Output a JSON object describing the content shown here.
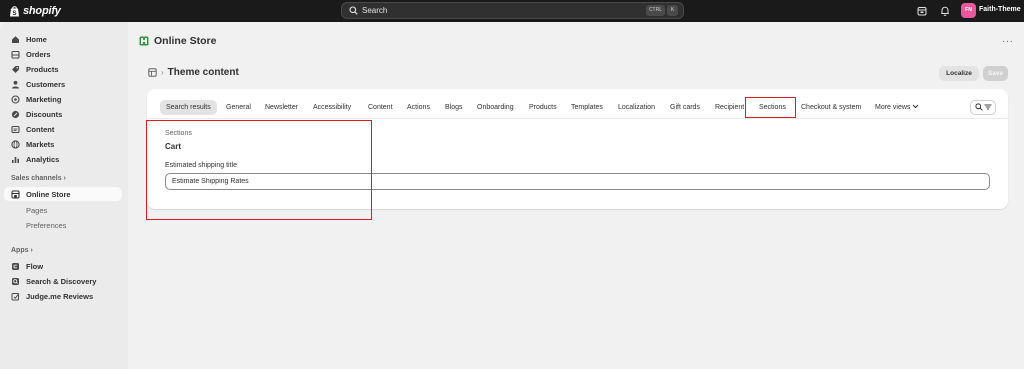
{
  "topbar": {
    "logo_text": "shopify",
    "search_label": "Search",
    "search_kbd_1": "CTRL",
    "search_kbd_2": "K",
    "avatar_initials": "FN",
    "store_name": "Faith-Theme"
  },
  "sidebar": {
    "items": [
      {
        "label": "Home",
        "icon": "home-icon"
      },
      {
        "label": "Orders",
        "icon": "orders-icon"
      },
      {
        "label": "Products",
        "icon": "tag-icon"
      },
      {
        "label": "Customers",
        "icon": "person-icon"
      },
      {
        "label": "Marketing",
        "icon": "target-icon"
      },
      {
        "label": "Discounts",
        "icon": "discount-icon"
      },
      {
        "label": "Content",
        "icon": "content-icon"
      },
      {
        "label": "Markets",
        "icon": "globe-icon"
      },
      {
        "label": "Analytics",
        "icon": "bar-chart-icon"
      }
    ],
    "sales_channels_label": "Sales channels",
    "online_store_label": "Online Store",
    "online_store_sub": [
      "Pages",
      "Preferences"
    ],
    "apps_label": "Apps",
    "apps": [
      {
        "label": "Flow",
        "icon": "flow-icon"
      },
      {
        "label": "Search & Discovery",
        "icon": "search-discovery-icon"
      },
      {
        "label": "Judge.me Reviews",
        "icon": "judgeme-icon"
      }
    ]
  },
  "header": {
    "title": "Online Store",
    "more": "···"
  },
  "theme_content": {
    "title": "Theme content",
    "localize_label": "Localize",
    "save_label": "Save"
  },
  "tabs": [
    "Search results",
    "General",
    "Newsletter",
    "Accessibility",
    "Content",
    "Actions",
    "Blogs",
    "Onboarding",
    "Products",
    "Templates",
    "Localization",
    "Gift cards",
    "Recipient",
    "Sections",
    "Checkout & system",
    "More views"
  ],
  "selected_tab": "Search results",
  "highlighted_tab": "Sections",
  "result": {
    "section_label": "Sections",
    "section_value": "Cart",
    "field_label": "Estimated shipping title",
    "field_value": "Estimate Shipping Rates"
  },
  "colors": {
    "topbar_bg": "#1a1a1a",
    "highlight": "#e01b24",
    "avatar": "#e9579c",
    "online_store_icon": "#2e9a3f"
  }
}
